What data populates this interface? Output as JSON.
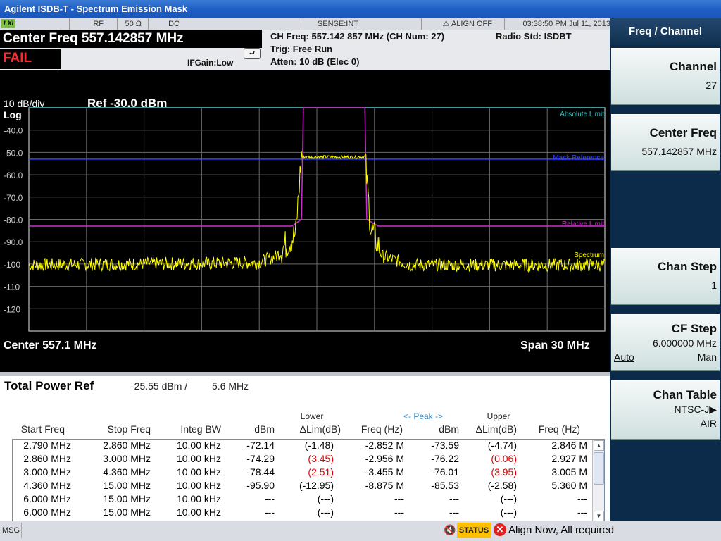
{
  "window": {
    "title": "Agilent ISDB-T - Spectrum Emission Mask"
  },
  "status_strip": {
    "lxi": "LXI",
    "rf": "RF",
    "impedance": "50 Ω",
    "coupling": "DC",
    "sense": "SENSE:INT",
    "align": "ALIGN OFF",
    "datetime": "03:38:50 PM Jul 11, 2013"
  },
  "header": {
    "center_freq": "Center Freq 557.142857 MHz",
    "result": "FAIL",
    "ifgain": "IFGain:Low",
    "ch_freq": "CH Freq: 557.142 857 MHz (CH Num: 27)",
    "trig": "Trig: Free Run",
    "atten": "Atten: 10 dB (Elec 0)",
    "radio_std": "Radio Std: ISDBT"
  },
  "graph": {
    "scale": "10 dB/div",
    "scale_type": "Log",
    "ref": "Ref -30.0 dBm",
    "yticks": [
      "-40.0",
      "-50.0",
      "-60.0",
      "-70.0",
      "-80.0",
      "-90.0",
      "-100",
      "-110",
      "-120"
    ],
    "legend_absolute": "Absolute Limit",
    "legend_mask": "Mask Reference",
    "legend_relative": "Relative Limit",
    "legend_spectrum": "Spectrum",
    "center": "Center  557.1 MHz",
    "span": "Span 30 MHz",
    "colors": {
      "spectrum": "#ffff00",
      "limit": "#c832c8",
      "absolute": "#33cccc",
      "mask": "#3344ff"
    }
  },
  "chart_data": {
    "type": "line",
    "xlabel": "",
    "ylabel": "",
    "x_range_mhz": [
      542.1,
      572.1
    ],
    "ylim": [
      -130,
      -30
    ],
    "series": [
      {
        "name": "Spectrum",
        "points": [
          [
            542.1,
            -101
          ],
          [
            554.0,
            -100
          ],
          [
            555.0,
            -97
          ],
          [
            556.0,
            -88
          ],
          [
            556.3,
            -52
          ],
          [
            559.6,
            -52
          ],
          [
            559.9,
            -85
          ],
          [
            560.5,
            -97
          ],
          [
            562.0,
            -101
          ],
          [
            572.1,
            -101
          ]
        ]
      },
      {
        "name": "Relative Limit",
        "points": [
          [
            542.1,
            -83
          ],
          [
            555.8,
            -83
          ],
          [
            556.3,
            -80
          ],
          [
            556.4,
            -30
          ],
          [
            559.6,
            -30
          ],
          [
            559.7,
            -80
          ],
          [
            560.3,
            -83
          ],
          [
            572.1,
            -83
          ]
        ]
      },
      {
        "name": "Absolute Limit",
        "points": [
          [
            542.1,
            -30
          ],
          [
            572.1,
            -30
          ]
        ]
      },
      {
        "name": "Mask Reference",
        "points": [
          [
            542.1,
            -53
          ],
          [
            572.1,
            -53
          ]
        ]
      }
    ]
  },
  "results": {
    "title": "Total Power Ref",
    "value": "-25.55 dBm /",
    "bw": "5.6 MHz",
    "group_lower": "Lower",
    "group_peak": "<- Peak ->",
    "group_upper": "Upper",
    "columns": [
      "Start Freq",
      "Stop Freq",
      "Integ BW",
      "dBm",
      "ΔLim(dB)",
      "Freq (Hz)",
      "dBm",
      "ΔLim(dB)",
      "Freq (Hz)"
    ],
    "rows": [
      {
        "c": [
          "2.790 MHz",
          "2.860 MHz",
          "10.00 kHz",
          "-72.14",
          "(-1.48)",
          "-2.852 M",
          "-73.59",
          "(-4.74)",
          "2.846 M"
        ],
        "red": [
          false,
          false
        ]
      },
      {
        "c": [
          "2.860 MHz",
          "3.000 MHz",
          "10.00 kHz",
          "-74.29",
          "(3.45)",
          "-2.956 M",
          "-76.22",
          "(0.06)",
          "2.927 M"
        ],
        "red": [
          true,
          true
        ]
      },
      {
        "c": [
          "3.000 MHz",
          "4.360 MHz",
          "10.00 kHz",
          "-78.44",
          "(2.51)",
          "-3.455 M",
          "-76.01",
          "(3.95)",
          "3.005 M"
        ],
        "red": [
          true,
          true
        ]
      },
      {
        "c": [
          "4.360 MHz",
          "15.00 MHz",
          "10.00 kHz",
          "-95.90",
          "(-12.95)",
          "-8.875 M",
          "-85.53",
          "(-2.58)",
          "5.360 M"
        ],
        "red": [
          false,
          false
        ]
      },
      {
        "c": [
          "6.000 MHz",
          "15.00 MHz",
          "10.00 kHz",
          "---",
          "(---)",
          "---",
          "---",
          "(---)",
          "---"
        ],
        "red": [
          false,
          false
        ]
      },
      {
        "c": [
          "6.000 MHz",
          "15.00 MHz",
          "10.00 kHz",
          "---",
          "(---)",
          "---",
          "---",
          "(---)",
          "---"
        ],
        "red": [
          false,
          false
        ]
      }
    ]
  },
  "bottom": {
    "msg": "MSG",
    "status": "STATUS",
    "error": "Align Now, All required"
  },
  "menu": {
    "title": "Freq / Channel",
    "channel_label": "Channel",
    "channel_value": "27",
    "cf_label": "Center Freq",
    "cf_value": "557.142857 MHz",
    "chanstep_label": "Chan Step",
    "chanstep_value": "1",
    "cfstep_label": "CF Step",
    "cfstep_value": "6.000000 MHz",
    "cfstep_auto": "Auto",
    "cfstep_man": "Man",
    "chantable_label": "Chan Table",
    "chantable_value1": "NTSC-J",
    "chantable_value2": "AIR"
  }
}
